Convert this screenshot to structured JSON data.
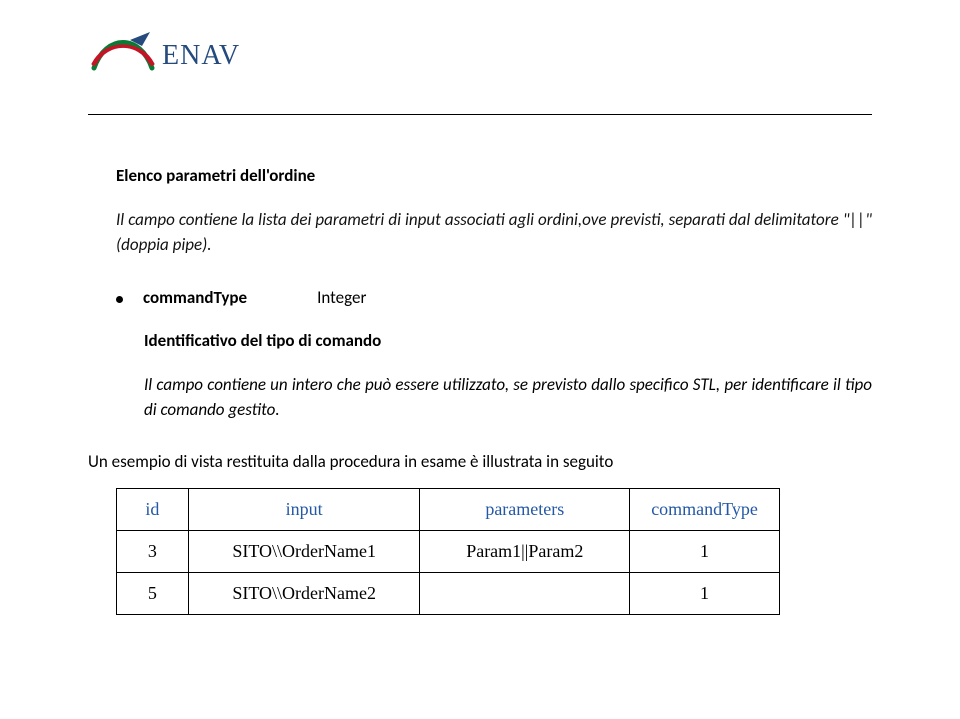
{
  "logo": {
    "text": "ENAV"
  },
  "section": {
    "heading": "Elenco parametri dell'ordine",
    "body": "Il campo contiene la lista dei parametri di input associati agli ordini,ove previsti, separati dal delimitatore \"||\" (doppia pipe)."
  },
  "field": {
    "name": "commandType",
    "type": "Integer",
    "subheading": "Identificativo del tipo di comando",
    "subbody": "Il campo contiene un intero che può essere utilizzato, se previsto dallo specifico STL, per identificare il tipo di comando gestito."
  },
  "example": {
    "intro": "Un esempio di vista restituita dalla procedura in esame è illustrata in seguito",
    "headers": {
      "c1": "id",
      "c2": "input",
      "c3": "parameters",
      "c4": "commandType"
    },
    "rows": [
      {
        "id": "3",
        "input": "SITO\\\\OrderName1",
        "parameters": "Param1||Param2",
        "commandType": "1"
      },
      {
        "id": "5",
        "input": "SITO\\\\OrderName2",
        "parameters": "",
        "commandType": "1"
      }
    ]
  }
}
